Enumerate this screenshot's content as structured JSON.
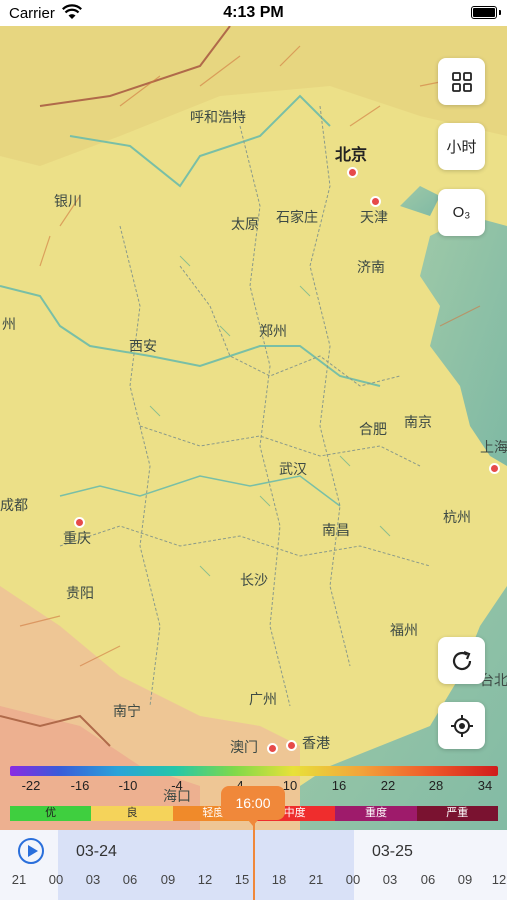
{
  "status_bar": {
    "carrier": "Carrier",
    "time": "4:13 PM"
  },
  "map": {
    "cities": [
      {
        "id": "hohhot",
        "label": "呼和浩特"
      },
      {
        "id": "beijing",
        "label": "北京"
      },
      {
        "id": "yinchuan",
        "label": "银川"
      },
      {
        "id": "taiyuan",
        "label": "太原"
      },
      {
        "id": "shijiazhuang",
        "label": "石家庄"
      },
      {
        "id": "tianjin",
        "label": "天津"
      },
      {
        "id": "jinan",
        "label": "济南"
      },
      {
        "id": "lanzhou",
        "label": "州"
      },
      {
        "id": "xian",
        "label": "西安"
      },
      {
        "id": "zhengzhou",
        "label": "郑州"
      },
      {
        "id": "hefei",
        "label": "合肥"
      },
      {
        "id": "nanjing",
        "label": "南京"
      },
      {
        "id": "shanghai",
        "label": "上海"
      },
      {
        "id": "wuhan",
        "label": "武汉"
      },
      {
        "id": "chengdu",
        "label": "成都"
      },
      {
        "id": "chongqing",
        "label": "重庆"
      },
      {
        "id": "nanchang",
        "label": "南昌"
      },
      {
        "id": "hangzhou",
        "label": "杭州"
      },
      {
        "id": "changsha",
        "label": "长沙"
      },
      {
        "id": "guiyang",
        "label": "贵阳"
      },
      {
        "id": "fuzhou",
        "label": "福州"
      },
      {
        "id": "taibei",
        "label": "台北"
      },
      {
        "id": "nanning",
        "label": "南宁"
      },
      {
        "id": "guangzhou",
        "label": "广州"
      },
      {
        "id": "macau",
        "label": "澳门"
      },
      {
        "id": "hongkong",
        "label": "香港"
      },
      {
        "id": "haikou",
        "label": "海口"
      }
    ]
  },
  "controls": {
    "grid_label": "grid",
    "hour_label": "小时",
    "pollutant_label": "O₃"
  },
  "scale": {
    "ticks": [
      "-22",
      "-16",
      "-10",
      "-4",
      "4",
      "10",
      "16",
      "22",
      "28",
      "34"
    ]
  },
  "aqi_levels": [
    {
      "label": "优",
      "color": "#3fcf3f"
    },
    {
      "label": "良",
      "color": "#f5d35a"
    },
    {
      "label": "轻度",
      "color": "#f08a2a"
    },
    {
      "label": "中度",
      "color": "#ef2d2d"
    },
    {
      "label": "重度",
      "color": "#9e1b6b"
    },
    {
      "label": "严重",
      "color": "#7a1230"
    }
  ],
  "timeline": {
    "current_time": "16:00",
    "dates": [
      "03-24",
      "03-25"
    ],
    "hours": [
      "21",
      "00",
      "03",
      "06",
      "09",
      "12",
      "15",
      "18",
      "21",
      "00",
      "03",
      "06",
      "09",
      "12"
    ]
  }
}
